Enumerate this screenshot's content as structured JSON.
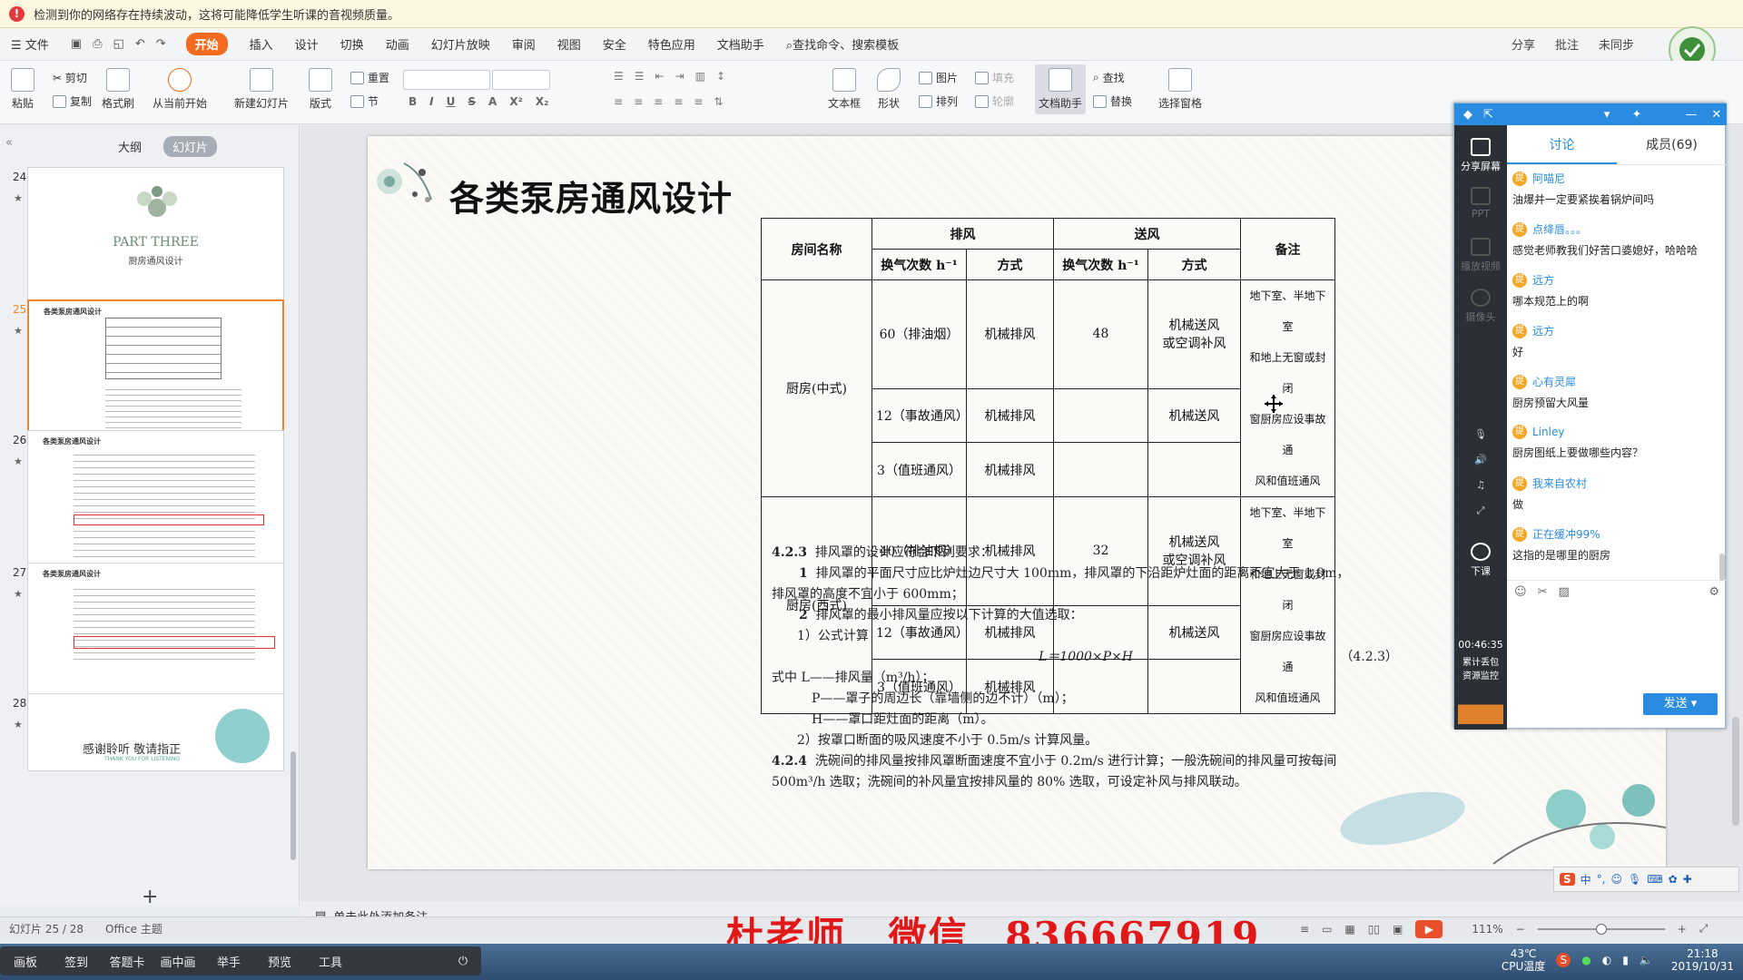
{
  "warning": {
    "text": "检测到你的网络存在持续波动，这将可能降低学生听课的音视频质量。"
  },
  "menubar": {
    "file": "文件",
    "tabs": [
      "开始",
      "插入",
      "设计",
      "切换",
      "动画",
      "幻灯片放映",
      "审阅",
      "视图",
      "安全",
      "特色应用",
      "文档助手"
    ],
    "search": "查找命令、搜索模板",
    "right": [
      "分享",
      "批注",
      "未同步"
    ]
  },
  "ribbon": {
    "paste": "粘贴",
    "cut": "剪切",
    "copy": "复制",
    "format_painter": "格式刷",
    "from_start": "从当前开始",
    "new_slide": "新建幻灯片",
    "layout": "版式",
    "reset": "重置",
    "section": "节",
    "textbox": "文本框",
    "shape": "形状",
    "picture": "图片",
    "fill": "填充",
    "arrange": "排列",
    "outline": "轮廓",
    "doc_assistant": "文档助手",
    "find": "查找",
    "replace": "替换",
    "select_pane": "选择窗格"
  },
  "sidebar": {
    "tabs": [
      "大纲",
      "幻灯片"
    ],
    "slides": [
      {
        "num": "24",
        "title": "PART THREE",
        "subtitle": "厨房通风设计"
      },
      {
        "num": "25",
        "title": "各类泵房通风设计"
      },
      {
        "num": "26",
        "title": "各类泵房通风设计"
      },
      {
        "num": "27",
        "title": "各类泵房通风设计"
      },
      {
        "num": "28",
        "title": "感谢聆听 敬请指正",
        "subtitle": "THANK YOU FOR LISTENING"
      }
    ]
  },
  "slide": {
    "title": "各类泵房通风设计",
    "table": {
      "h_room": "房间名称",
      "h_exhaust": "排风",
      "h_supply": "送风",
      "h_note": "备注",
      "h_ach": "换气次数 h⁻¹",
      "h_mode": "方式",
      "rows": [
        {
          "room": "厨房(中式)",
          "ach1": "60（排油烟）",
          "m1": "机械排风",
          "s1": "48",
          "sm1a": "机械送风",
          "sm1b": "或空调补风",
          "ach2": "12（事故通风）",
          "m2": "机械排风",
          "sm2": "机械送风",
          "ach3": "3（值班通风）",
          "m3": "机械排风",
          "note": [
            "地下室、半地下室",
            "和地上无窗或封闭",
            "窗厨房应设事故通",
            "风和值班通风"
          ]
        },
        {
          "room": "厨房(西式)",
          "ach1": "40（排油烟）",
          "m1": "机械排风",
          "s1": "32",
          "sm1a": "机械送风",
          "sm1b": "或空调补风",
          "ach2": "12（事故通风）",
          "m2": "机械排风",
          "sm2": "机械送风",
          "ach3": "3（值班通风）",
          "m3": "机械排风",
          "note": [
            "地下室、半地下室",
            "和地上无窗或封闭",
            "窗厨房应设事故通",
            "风和值班通风"
          ]
        }
      ]
    },
    "text": {
      "l1a": "4.2.3",
      "l1b": "排风罩的设计应符合下列要求：",
      "l2a": "1",
      "l2b": "排风罩的平面尺寸应比炉灶边尺寸大 100mm，排风罩的下沿距炉灶面的距离不宜大于 1.0m，",
      "l3": "排风罩的高度不宜小于 600mm；",
      "l4a": "2",
      "l4b": "排风罩的最小排风量应按以下计算的大值选取：",
      "l5": "1）公式计算",
      "formula": "L＝1000×P×H",
      "formula_no": "（4.2.3）",
      "l6": "式中  L——排风量（m³/h）；",
      "l7": "P——罩子的周边长（靠墙侧的边不计）（m）；",
      "l8": "H——罩口距灶面的距离（m）。",
      "l9": "2）按罩口断面的吸风速度不小于 0.5m/s 计算风量。",
      "l10a": "4.2.4",
      "l10b": "洗碗间的排风量按排风罩断面速度不宜小于 0.2m/s 进行计算；一般洗碗间的排风量可按每间",
      "l11": "500m³/h 选取；洗碗间的补风量宜按排风量的 80% 选取，可设定补风与排风联动。"
    }
  },
  "chat": {
    "tabs": [
      "讨论",
      "成员(69)"
    ],
    "left": [
      "分享屏幕",
      "PPT",
      "播放视频",
      "摄像头",
      "下课"
    ],
    "timer": "00:46:35",
    "stats": [
      "累计丢包",
      "资源监控"
    ],
    "messages": [
      {
        "name": "阿喵尼",
        "text": "油爆并一定要紧挨着锅炉间吗"
      },
      {
        "name": "点绛唇。。。",
        "text": "感觉老师教我们好苦口婆媳好，哈哈哈"
      },
      {
        "name": "远方",
        "text": "哪本规范上的啊"
      },
      {
        "name": "远方",
        "text": "好"
      },
      {
        "name": "心有灵犀",
        "text": "厨房预留大风量"
      },
      {
        "name": "Linley",
        "text": "厨房图纸上要做哪些内容？"
      },
      {
        "name": "我来自农村",
        "text": "做"
      },
      {
        "name": "正在缓冲99%",
        "text": "这指的是哪里的厨房"
      }
    ],
    "send": "发送"
  },
  "notes": "单击此处添加备注",
  "status": {
    "slide_info": "幻灯片 25 / 28",
    "theme": "Office 主题",
    "zoom": "111%"
  },
  "banner": {
    "teacher": "杜老师",
    "wechat": "微信",
    "number": "836667919"
  },
  "live_toolbar": [
    "画板",
    "签到",
    "答题卡",
    "画中画",
    "举手",
    "预览",
    "工具"
  ],
  "tray": {
    "temp": "43℃",
    "temp_label": "CPU温度",
    "time": "21:18",
    "date": "2019/10/31"
  },
  "ime": "中"
}
